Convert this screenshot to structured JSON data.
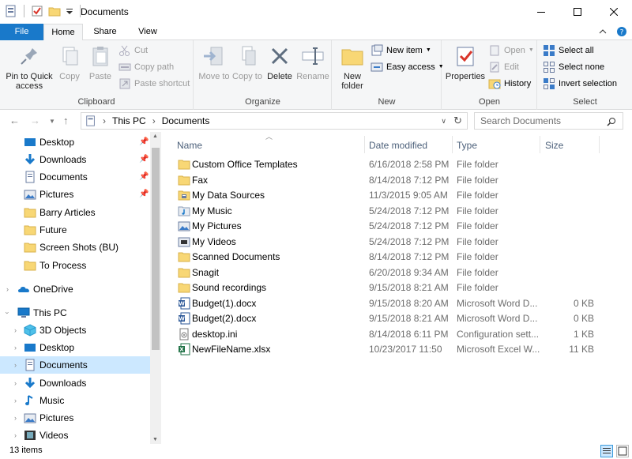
{
  "window": {
    "title": "Documents",
    "minimize": "—",
    "maximize": "☐",
    "close": "✕"
  },
  "tabs": {
    "file": "File",
    "home": "Home",
    "share": "Share",
    "view": "View"
  },
  "ribbon": {
    "clipboard": {
      "label": "Clipboard",
      "pin": "Pin to Quick access",
      "copy": "Copy",
      "paste": "Paste",
      "cut": "Cut",
      "copy_path": "Copy path",
      "paste_shortcut": "Paste shortcut"
    },
    "organize": {
      "label": "Organize",
      "move_to": "Move to",
      "copy_to": "Copy to",
      "delete": "Delete",
      "rename": "Rename"
    },
    "new": {
      "label": "New",
      "new_folder": "New folder",
      "new_item": "New item",
      "easy_access": "Easy access"
    },
    "open": {
      "label": "Open",
      "properties": "Properties",
      "open": "Open",
      "edit": "Edit",
      "history": "History"
    },
    "select": {
      "label": "Select",
      "select_all": "Select all",
      "select_none": "Select none",
      "invert": "Invert selection"
    }
  },
  "address": {
    "crumb1": "This PC",
    "crumb2": "Documents",
    "search_placeholder": "Search Documents"
  },
  "nav": {
    "quick": [
      "Desktop",
      "Downloads",
      "Documents",
      "Pictures",
      "Barry Articles",
      "Future",
      "Screen Shots (BU)",
      "To Process"
    ],
    "onedrive": "OneDrive",
    "thispc": "This PC",
    "pc_items": [
      "3D Objects",
      "Desktop",
      "Documents",
      "Downloads",
      "Music",
      "Pictures",
      "Videos"
    ]
  },
  "columns": {
    "name": "Name",
    "date": "Date modified",
    "type": "Type",
    "size": "Size"
  },
  "files": [
    {
      "name": "Custom Office Templates",
      "date": "6/16/2018 2:58 PM",
      "type": "File folder",
      "size": "",
      "icon": "folder"
    },
    {
      "name": "Fax",
      "date": "8/14/2018 7:12 PM",
      "type": "File folder",
      "size": "",
      "icon": "folder"
    },
    {
      "name": "My Data Sources",
      "date": "11/3/2015 9:05 AM",
      "type": "File folder",
      "size": "",
      "icon": "folder-data"
    },
    {
      "name": "My Music",
      "date": "5/24/2018 7:12 PM",
      "type": "File folder",
      "size": "",
      "icon": "music"
    },
    {
      "name": "My Pictures",
      "date": "5/24/2018 7:12 PM",
      "type": "File folder",
      "size": "",
      "icon": "pictures"
    },
    {
      "name": "My Videos",
      "date": "5/24/2018 7:12 PM",
      "type": "File folder",
      "size": "",
      "icon": "videos"
    },
    {
      "name": "Scanned Documents",
      "date": "8/14/2018 7:12 PM",
      "type": "File folder",
      "size": "",
      "icon": "folder"
    },
    {
      "name": "Snagit",
      "date": "6/20/2018 9:34 AM",
      "type": "File folder",
      "size": "",
      "icon": "folder"
    },
    {
      "name": "Sound recordings",
      "date": "9/15/2018 8:21 AM",
      "type": "File folder",
      "size": "",
      "icon": "folder"
    },
    {
      "name": "Budget(1).docx",
      "date": "9/15/2018 8:20 AM",
      "type": "Microsoft Word D...",
      "size": "0 KB",
      "icon": "word"
    },
    {
      "name": "Budget(2).docx",
      "date": "9/15/2018 8:21 AM",
      "type": "Microsoft Word D...",
      "size": "0 KB",
      "icon": "word"
    },
    {
      "name": "desktop.ini",
      "date": "8/14/2018 6:11 PM",
      "type": "Configuration sett...",
      "size": "1 KB",
      "icon": "ini"
    },
    {
      "name": "NewFileName.xlsx",
      "date": "10/23/2017 11:50",
      "type": "Microsoft Excel W...",
      "size": "11 KB",
      "icon": "excel"
    }
  ],
  "status": {
    "count": "13 items"
  },
  "colors": {
    "accent": "#1979ca",
    "folder": "#f8d775",
    "selection": "#cce8ff"
  }
}
